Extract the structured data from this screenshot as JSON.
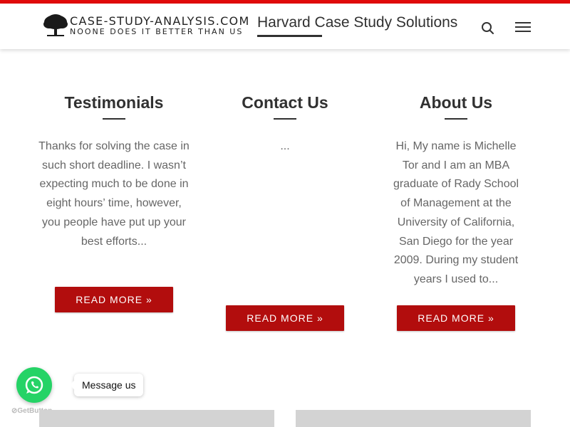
{
  "header": {
    "logo_line1": "CASE-STUDY-ANALYSIS.COM",
    "logo_line2": "NOONE DOES IT BETTER THAN US",
    "tagline": "Harvard Case Study Solutions",
    "search_icon": "search-icon",
    "menu_icon": "hamburger-menu-icon"
  },
  "columns": [
    {
      "title": "Testimonials",
      "text": "Thanks for solving the case in such short deadline. I wasn’t expecting much to be done in eight hours’ time, however, you people have put up your best efforts...",
      "button": "READ MORE »"
    },
    {
      "title": "Contact Us",
      "text": "...",
      "button": "READ MORE »"
    },
    {
      "title": "About Us",
      "text": "Hi, My name is Michelle Tor and I am an MBA graduate of Rady School of Management at the University of California, San Diego for the year 2009. During my student years I used to...",
      "button": "READ MORE »"
    }
  ],
  "widget": {
    "message_label": "Message us",
    "brand": "GetButton",
    "icon": "whatsapp-icon"
  },
  "colors": {
    "accent": "#b20d0d",
    "top_strip": "#e10b0b",
    "whatsapp": "#25d366"
  }
}
